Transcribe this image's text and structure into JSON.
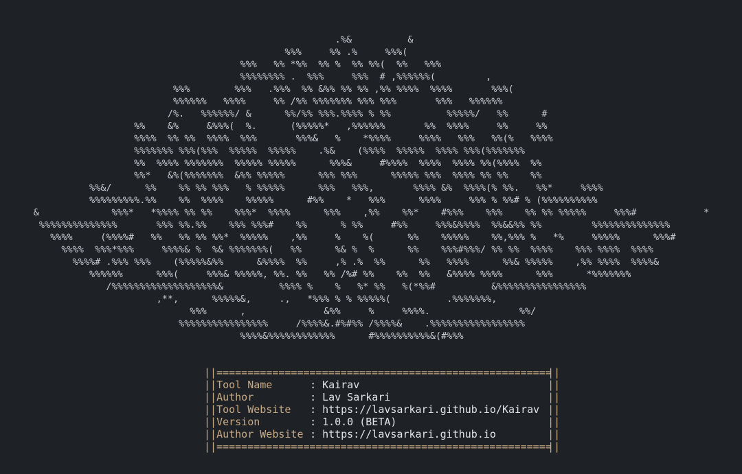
{
  "ascii_art": [
    "                                                            .%&          &",
    "                                                   %%%     %% .%     %%%(",
    "                                           %%%   %% *%%  %% %  %% %%(  %%   %%%",
    "                                           %%%%%%%% .  %%%     %%%  # ,%%%%%%(         ,",
    "                               %%%        %%%   .%%%  %% &%% %% %% ,%% %%%%  %%%%       %%%(",
    "                               %%%%%%   %%%%     %% /%% %%%%%%% %%% %%%       %%%   %%%%%%",
    "                              /%.   %%%%%%/ &      %%/%% %%%.%%%% % %%          %%%%%/   %%      #",
    "                        %%    &%     &%%%(  %.      (%%%%%*   ,%%%%%%       %%  %%%%     %%     %%",
    "                        %%%%  %% %%  %%%%  %%%       %%%&   %    *%%%%     %%%%   %%%   %%(%   %%%%",
    "                        %%%%%%% %%%(%%%  %%%%%  %%%%%    .%&    (%%%%  %%%%%  %%%% %%%(%%%%%%%",
    "                        %%  %%%% %%%%%%%  %%%%% %%%%%      %%%&     #%%%%  %%%%  %%%% %%(%%%%  %%",
    "                        %%*   &%(%%%%%%%  &%% %%%%%      %%% %%%      %%%%% %%%  %%%% %% %%    %%",
    "                %%&/      %%    %% %% %%%   % %%%%%      %%%   %%%,       %%%% &%  %%%%(% %%.   %%*     %%%%",
    "                %%%%%%%%%.%%    %%  %%%%    %%%%%      #%%    *   %%%      %%%%     %%% % %%# % (%%%%%%%%%%",
    "      &             %%%*   *%%%% %% %%    %%%*  %%%%      %%%    ,%%    %%*    #%%%    %%%    %% %% %%%%%     %%%#            *",
    "       %%%%%%%%%%%%%%       %%% %%.%%    %%% %%%#    %%      % %%     #%%     %%%&%%%%  %%&&%% %%         %%%%%%%%%%%%%%",
    "         %%%%     (%%%%#   %%   %% %% %%*  %%%%%    ,%%     %    %(      %%    %%%%%    %%,%%% %   *%     %%%%%      %%%#",
    "           %%%%  %%%*%%%     %%%%& %  %& %%%%%%%(   %%      %& %  %      %%    %%%#%%%/ %% %%  %%%%    %%% %%%%  %%%%",
    "             %%%%# .%%% %%%    (%%%%%&%%      &%%%%  %%     ,% .%  %%      %%   %%%%      %%& %%%%%    ,%% %%%%  %%%%&",
    "                %%%%%%      %%%(     %%%& %%%%%, %%. %%   %% /%# %%    %%  %%   &%%%% %%%%      %%%      *%%%%%%%",
    "                   /%%%%%%%%%%%%%%%%%%%&          %%%% %    %   %* %%   %(*%%#          &%%%%%%%%%%%%%%%%",
    "                            ,**,      %%%%%&,     .,   *%%% % % %%%%%(          .%%%%%%%,",
    "                                  %%%      ,              &%%     %     %%%%.                %%/",
    "                                %%%%%%%%%%%%%%%%     /%%%%&.#%#%% /%%%%&    .%%%%%%%%%%%%%%%%%",
    "                                           %%%%&%%%%%%%%%%%%      #%%%%%%%%%%&(#%%%"
  ],
  "info_box": {
    "rule": "======================================================",
    "rows": [
      {
        "label": "Tool Name",
        "value": "Kairav"
      },
      {
        "label": "Author",
        "value": "Lav Sarkari"
      },
      {
        "label": "Tool Website",
        "value": "https://lavsarkari.github.io/Kairav"
      },
      {
        "label": "Version",
        "value": "1.0.0 (BETA)"
      },
      {
        "label": "Author Website",
        "value": "https://lavsarkari.github.io"
      }
    ],
    "separator": ":",
    "border": "||"
  },
  "colors": {
    "background": "#1e2126",
    "art_text": "#c9cdd2",
    "label": "#c8aa84",
    "value": "#e2e4e7"
  }
}
